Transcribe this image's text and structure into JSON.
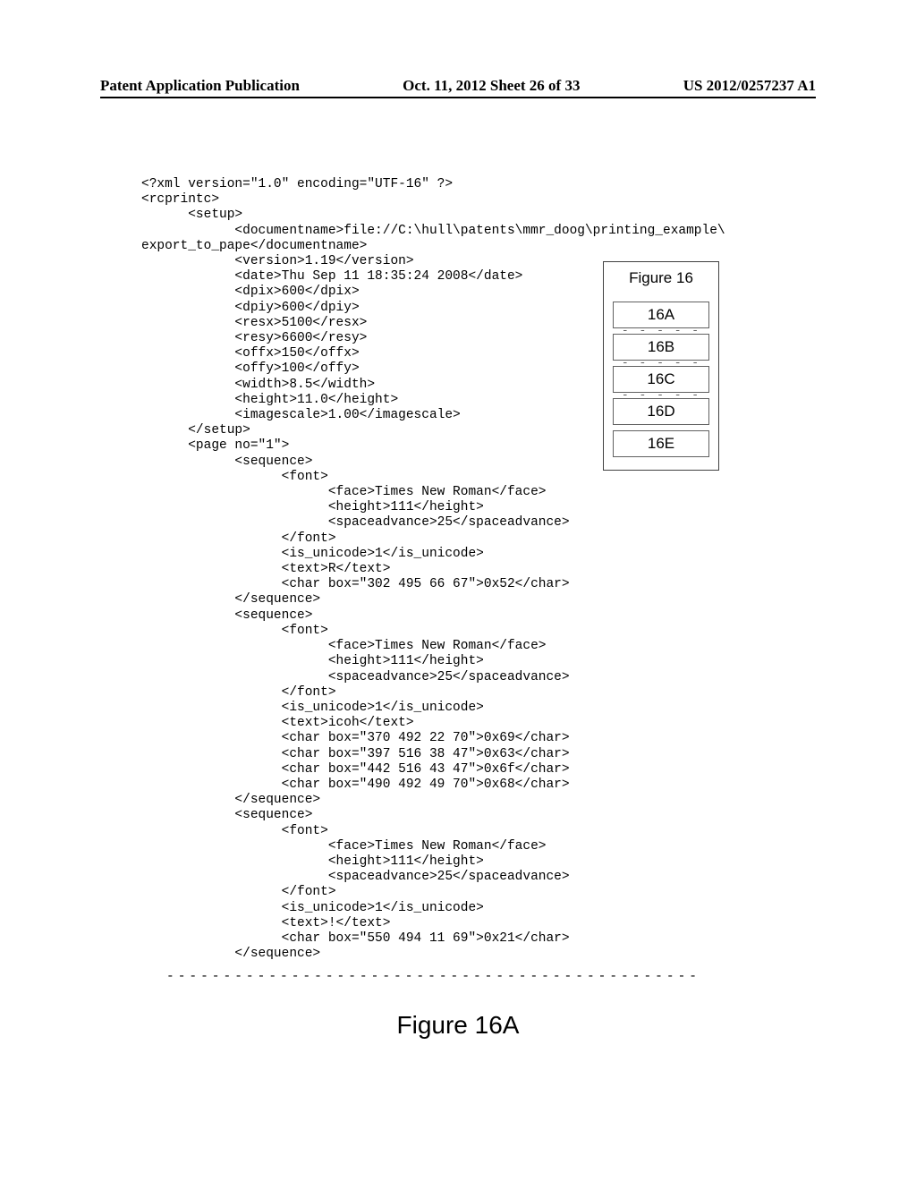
{
  "header": {
    "left": "Patent Application Publication",
    "center": "Oct. 11, 2012  Sheet 26 of 33",
    "right": "US 2012/0257237 A1"
  },
  "xml": {
    "lines": [
      "<?xml version=\"1.0\" encoding=\"UTF-16\" ?>",
      "<rcprintc>",
      "      <setup>",
      "            <documentname>file://C:\\hull\\patents\\mmr_doog\\printing_example\\",
      "export_to_pape</documentname>",
      "            <version>1.19</version>",
      "            <date>Thu Sep 11 18:35:24 2008</date>",
      "            <dpix>600</dpix>",
      "            <dpiy>600</dpiy>",
      "            <resx>5100</resx>",
      "            <resy>6600</resy>",
      "            <offx>150</offx>",
      "            <offy>100</offy>",
      "            <width>8.5</width>",
      "            <height>11.0</height>",
      "            <imagescale>1.00</imagescale>",
      "      </setup>",
      "      <page no=\"1\">",
      "            <sequence>",
      "                  <font>",
      "                        <face>Times New Roman</face>",
      "                        <height>111</height>",
      "                        <spaceadvance>25</spaceadvance>",
      "                  </font>",
      "                  <is_unicode>1</is_unicode>",
      "                  <text>R</text>",
      "                  <char box=\"302 495 66 67\">0x52</char>",
      "            </sequence>",
      "            <sequence>",
      "                  <font>",
      "                        <face>Times New Roman</face>",
      "                        <height>111</height>",
      "                        <spaceadvance>25</spaceadvance>",
      "                  </font>",
      "                  <is_unicode>1</is_unicode>",
      "                  <text>icoh</text>",
      "                  <char box=\"370 492 22 70\">0x69</char>",
      "                  <char box=\"397 516 38 47\">0x63</char>",
      "                  <char box=\"442 516 43 47\">0x6f</char>",
      "                  <char box=\"490 492 49 70\">0x68</char>",
      "            </sequence>",
      "            <sequence>",
      "                  <font>",
      "                        <face>Times New Roman</face>",
      "                        <height>111</height>",
      "                        <spaceadvance>25</spaceadvance>",
      "                  </font>",
      "                  <is_unicode>1</is_unicode>",
      "                  <text>!</text>",
      "                  <char box=\"550 494 11 69\">0x21</char>",
      "            </sequence>"
    ]
  },
  "separator": "------------------------------------------------",
  "caption": "Figure 16A",
  "navbox": {
    "title": "Figure 16",
    "items": [
      "16A",
      "16B",
      "16C",
      "16D",
      "16E"
    ]
  }
}
